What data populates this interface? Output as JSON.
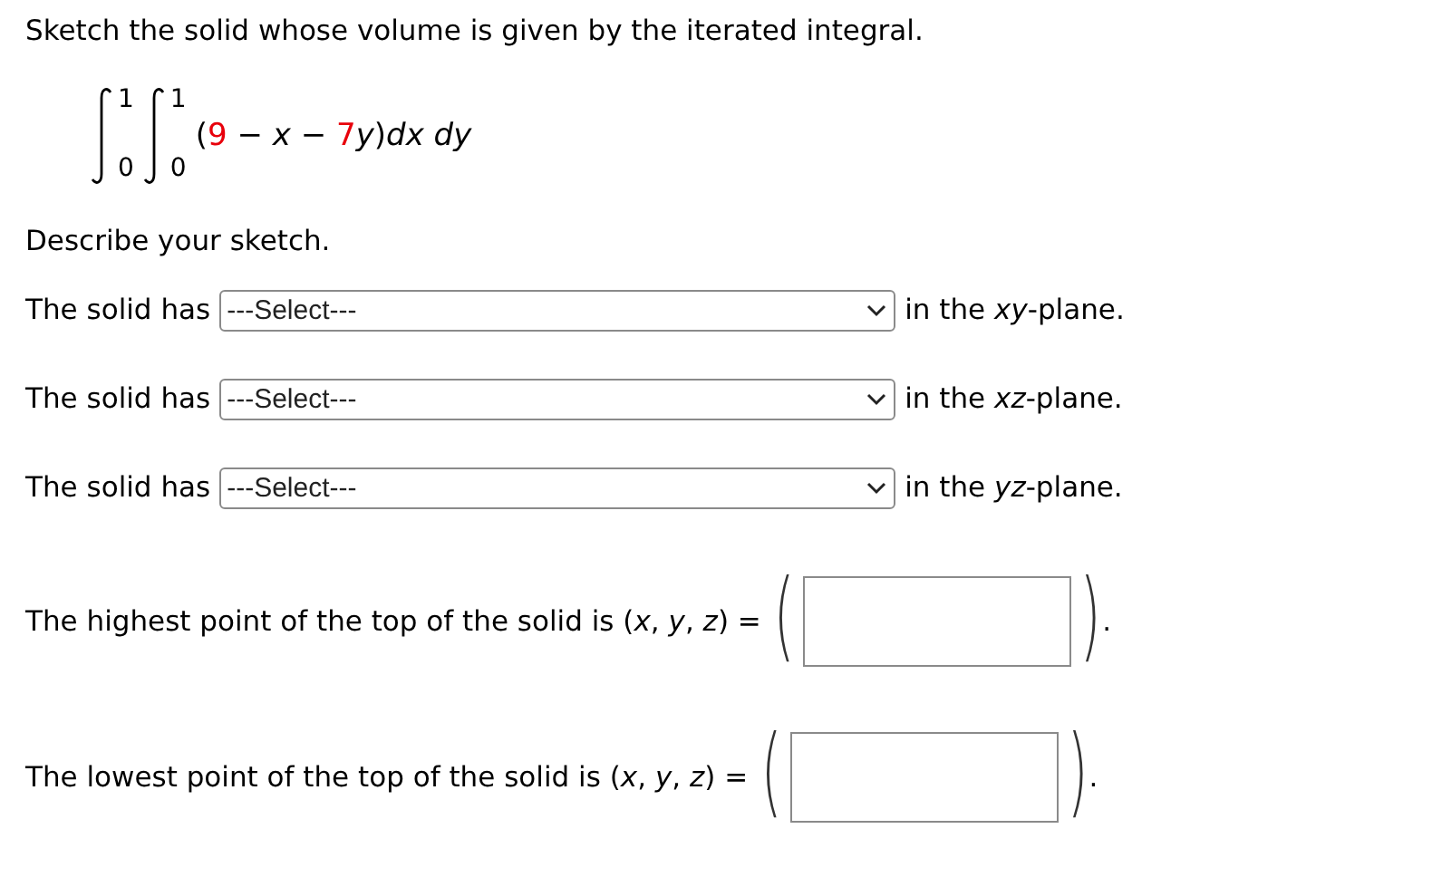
{
  "prompt": "Sketch the solid whose volume is given by the iterated integral.",
  "integral": {
    "outer": {
      "lower": "0",
      "upper": "1"
    },
    "inner": {
      "lower": "0",
      "upper": "1"
    },
    "integrand": [
      {
        "text": "(",
        "color": "#000000"
      },
      {
        "text": "9",
        "color": "#e8000b"
      },
      {
        "text": " − *x* − ",
        "color": "#000000"
      },
      {
        "text": "7",
        "color": "#e8000b"
      },
      {
        "text": "*y*)*dx dy*",
        "color": "#000000"
      }
    ]
  },
  "describe": "Describe your sketch.",
  "selects": [
    {
      "prefix": "The solid has",
      "value": "---Select---",
      "suffix": "in the *xy*-plane."
    },
    {
      "prefix": "The solid has",
      "value": "---Select---",
      "suffix": "in the *xz*-plane."
    },
    {
      "prefix": "The solid has",
      "value": "---Select---",
      "suffix": "in the *yz*-plane."
    }
  ],
  "points": [
    {
      "label": "The highest point of the top of the solid is (*x*, *y*, *z*) =",
      "open": "(",
      "close": ")",
      "end": "."
    },
    {
      "label": "The lowest point of the top of the solid is (*x*, *y*, *z*) =",
      "open": "(",
      "close": ")",
      "end": "."
    }
  ]
}
